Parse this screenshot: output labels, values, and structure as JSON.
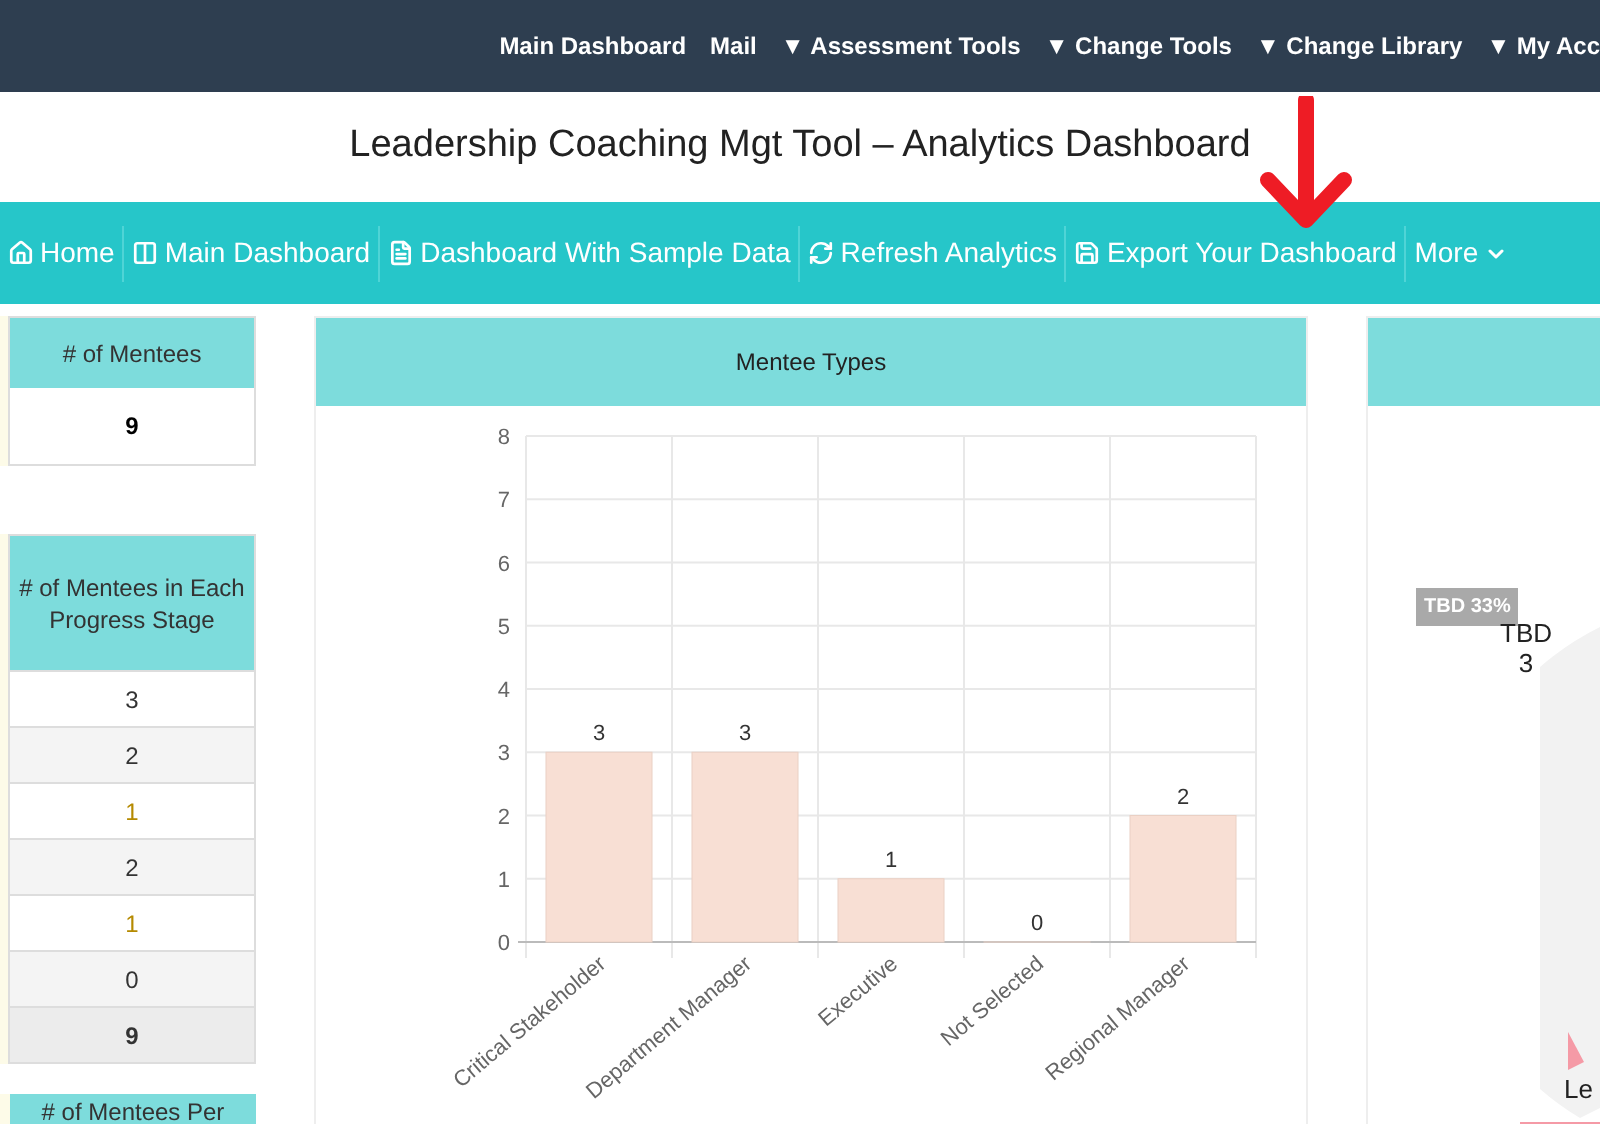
{
  "top_nav": [
    {
      "label": "Main Dashboard"
    },
    {
      "label": "Mail"
    },
    {
      "label": "▼ Assessment Tools"
    },
    {
      "label": "▼ Change Tools"
    },
    {
      "label": "▼ Change Library"
    },
    {
      "label": "▼ My Acc"
    }
  ],
  "page_title": "Leadership Coaching Mgt Tool – Analytics Dashboard",
  "toolbar": [
    {
      "label": "Home"
    },
    {
      "label": "Main Dashboard"
    },
    {
      "label": "Dashboard With Sample Data"
    },
    {
      "label": "Refresh Analytics"
    },
    {
      "label": "Export Your Dashboard"
    },
    {
      "label": "More"
    }
  ],
  "mentee_count_table": {
    "header": "# of Mentees",
    "rows": [
      {
        "value": "9"
      }
    ]
  },
  "progress_table": {
    "header": "# of Mentees in Each Progress Stage",
    "rows": [
      {
        "value": "3",
        "kind": "plain",
        "color": "#333333"
      },
      {
        "value": "2",
        "kind": "plain",
        "color": "#333333"
      },
      {
        "value": "1",
        "kind": "plain",
        "color": "#b58a00"
      },
      {
        "value": "2",
        "kind": "plain",
        "color": "#333333"
      },
      {
        "value": "1",
        "kind": "plain",
        "color": "#b58a00"
      },
      {
        "value": "0",
        "kind": "plain",
        "color": "#333333"
      },
      {
        "value": "9",
        "kind": "total",
        "color": "#333333"
      }
    ]
  },
  "third_table": {
    "header": "# of Mentees Per"
  },
  "mentee_types": {
    "title": "Mentee Types",
    "chart_data": {
      "type": "bar",
      "categories": [
        "Critical Stakeholder",
        "Department Manager",
        "Executive",
        "Not Selected",
        "Regional Manager"
      ],
      "series": [
        {
          "color": "#f8dfd4",
          "values": [
            3,
            3,
            1,
            0,
            2
          ]
        }
      ],
      "ylim": [
        0,
        8
      ],
      "yticks": [
        0,
        1,
        2,
        3,
        4,
        5,
        6,
        7,
        8
      ],
      "grid": true,
      "data_labels": true
    }
  },
  "pie_panel": {
    "tag": "TBD 33%",
    "label": "TBD",
    "count": "3",
    "bottom_label": "Le"
  }
}
